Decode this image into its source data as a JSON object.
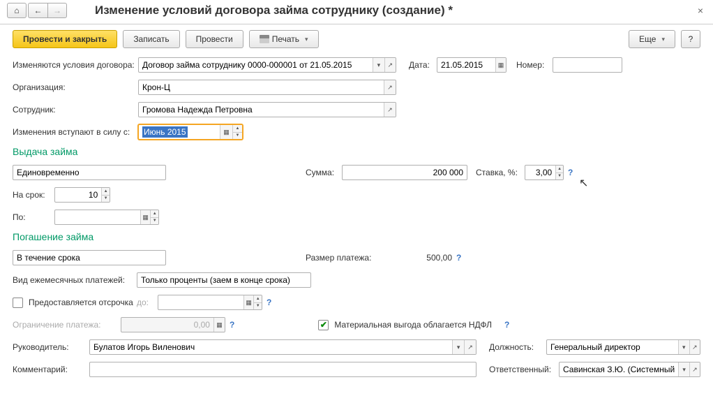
{
  "header": {
    "title": "Изменение условий договора займа сотруднику (создание) *"
  },
  "toolbar": {
    "post_close": "Провести и закрыть",
    "write": "Записать",
    "post": "Провести",
    "print": "Печать",
    "more": "Еще",
    "help": "?"
  },
  "fields": {
    "change_conditions_lbl": "Изменяются условия договора:",
    "change_conditions": "Договор займа сотруднику 0000-000001 от 21.05.2015",
    "date_lbl": "Дата:",
    "date": "21.05.2015",
    "number_lbl": "Номер:",
    "number": "",
    "org_lbl": "Организация:",
    "org": "Крон-Ц",
    "employee_lbl": "Сотрудник:",
    "employee": "Громова Надежда Петровна",
    "effective_lbl": "Изменения вступают в силу с:",
    "effective": "Июнь 2015"
  },
  "issue": {
    "section": "Выдача займа",
    "mode": "Единовременно",
    "sum_lbl": "Сумма:",
    "sum": "200 000",
    "rate_lbl": "Ставка, %:",
    "rate": "3,00",
    "term_lbl": "На срок:",
    "term": "10",
    "till_lbl": "По:",
    "till": ""
  },
  "repay": {
    "section": "Погашение займа",
    "mode": "В течение срока",
    "payment_lbl": "Размер платежа:",
    "payment": "500,00",
    "monthly_type_lbl": "Вид ежемесячных платежей:",
    "monthly_type": "Только проценты (заем в конце срока)",
    "delay_label": "Предоставляется отсрочка",
    "delay_till_lbl": "до:",
    "delay_till": "",
    "limit_lbl": "Ограничение платежа:",
    "limit": "0,00",
    "ndfl": "Материальная выгода облагается НДФЛ"
  },
  "footer": {
    "manager_lbl": "Руководитель:",
    "manager": "Булатов Игорь Виленович",
    "position_lbl": "Должность:",
    "position": "Генеральный директор",
    "comment_lbl": "Комментарий:",
    "comment": "",
    "responsible_lbl": "Ответственный:",
    "responsible": "Савинская З.Ю. (Системный про"
  }
}
